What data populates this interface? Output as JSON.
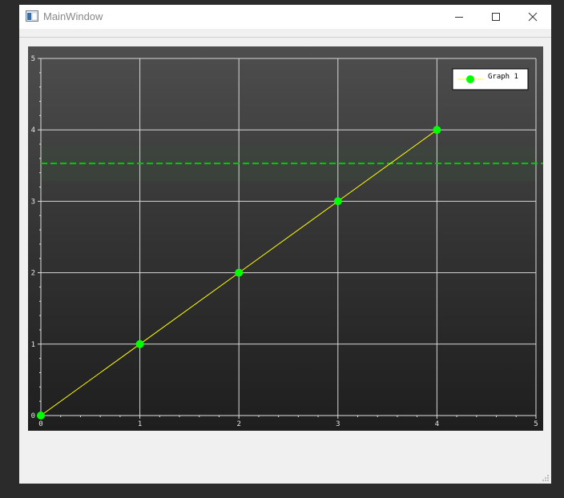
{
  "window": {
    "title": "MainWindow"
  },
  "chart_data": {
    "type": "line",
    "title": "",
    "xlabel": "",
    "ylabel": "",
    "xlim": [
      0,
      5
    ],
    "ylim": [
      0,
      5
    ],
    "x_ticks": [
      "0",
      "1",
      "2",
      "3",
      "4",
      "5"
    ],
    "y_ticks": [
      "0",
      "1",
      "2",
      "3",
      "4",
      "5"
    ],
    "grid": true,
    "legend": "top-right",
    "background": "dark gradient",
    "series": [
      {
        "name": "Graph 1",
        "x": [
          0,
          1,
          2,
          3,
          4
        ],
        "y": [
          0,
          1,
          2,
          3,
          4
        ],
        "line_color": "#ffff00",
        "marker_color": "#00ff00"
      }
    ],
    "reference_line": {
      "y": 3.53,
      "style": "dashed",
      "color": "#00cc00"
    }
  }
}
